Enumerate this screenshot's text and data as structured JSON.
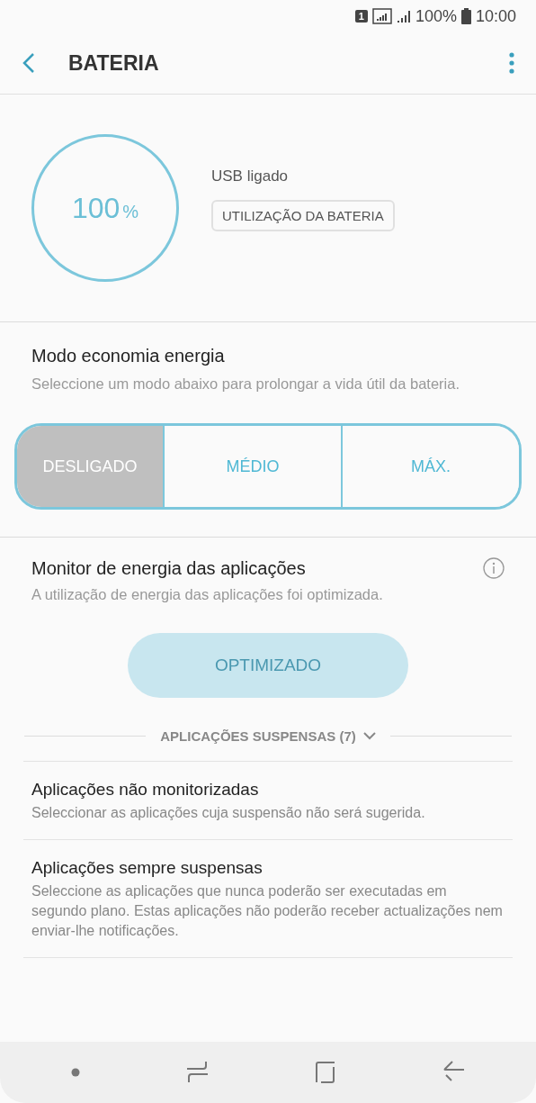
{
  "status_bar": {
    "sim": "1",
    "battery": "100%",
    "time": "10:00"
  },
  "header": {
    "title": "BATERIA"
  },
  "battery": {
    "percent": "100",
    "unit": "%",
    "status": "USB ligado",
    "usage_button": "UTILIZAÇÃO DA BATERIA"
  },
  "power_mode": {
    "title": "Modo economia energia",
    "description": "Seleccione um modo abaixo para prolongar a vida útil da bateria.",
    "options": [
      {
        "label": "DESLIGADO",
        "selected": true
      },
      {
        "label": "MÉDIO",
        "selected": false
      },
      {
        "label": "MÁX.",
        "selected": false
      }
    ]
  },
  "app_monitor": {
    "title": "Monitor de energia das aplicações",
    "description": "A utilização de energia das aplicações foi optimizada.",
    "button": {
      "label": "OPTIMIZADO",
      "disabled": true
    },
    "suspended": {
      "label": "APLICAÇÕES SUSPENSAS (7)",
      "expanded": false
    }
  },
  "items": [
    {
      "title": "Aplicações não monitorizadas",
      "description": "Seleccionar as aplicações cuja suspensão não será sugerida."
    },
    {
      "title": "Aplicações sempre suspensas",
      "description": "Seleccione as aplicações que nunca poderão ser executadas em segundo plano. Estas aplicações não poderão receber actualizações nem enviar-lhe notificações."
    }
  ]
}
